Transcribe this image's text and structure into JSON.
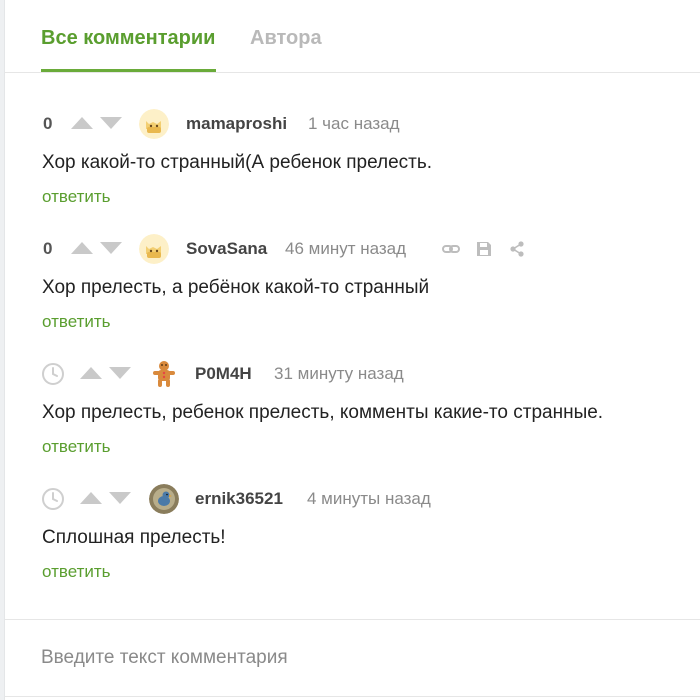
{
  "tabs": {
    "all_comments": "Все комментарии",
    "author": "Автора"
  },
  "comments": [
    {
      "rating": "0",
      "username": "mamaproshi",
      "time": "1 час назад",
      "text": "Хор какой-то странный(А ребенок прелесть.",
      "reply": "ответить",
      "avatar_icon": "cat-avatar-icon"
    },
    {
      "rating": "0",
      "username": "SovaSana",
      "time": "46 минут назад",
      "text": "Хор прелесть, а ребёнок какой-то странный",
      "reply": "ответить",
      "avatar_icon": "cat-avatar-icon",
      "tools": [
        "link-icon",
        "save-icon",
        "share-icon"
      ]
    },
    {
      "username": "P0M4H",
      "time": "31 минуту назад",
      "text": "Хор прелесть, ребенок прелесть, комменты какие-то странные.",
      "reply": "ответить",
      "avatar_icon": "gingerbread-avatar-icon"
    },
    {
      "username": "ernik36521",
      "time": "4 минуты назад",
      "text": "Сплошная прелесть!",
      "reply": "ответить",
      "avatar_icon": "bird-avatar-icon"
    }
  ],
  "comment_input": {
    "placeholder": "Введите текст комментария",
    "value": ""
  },
  "colors": {
    "accent_green": "#5a9e2f",
    "inactive_tab": "#b9b9b9",
    "arrow_gray": "#c9c9c9"
  }
}
